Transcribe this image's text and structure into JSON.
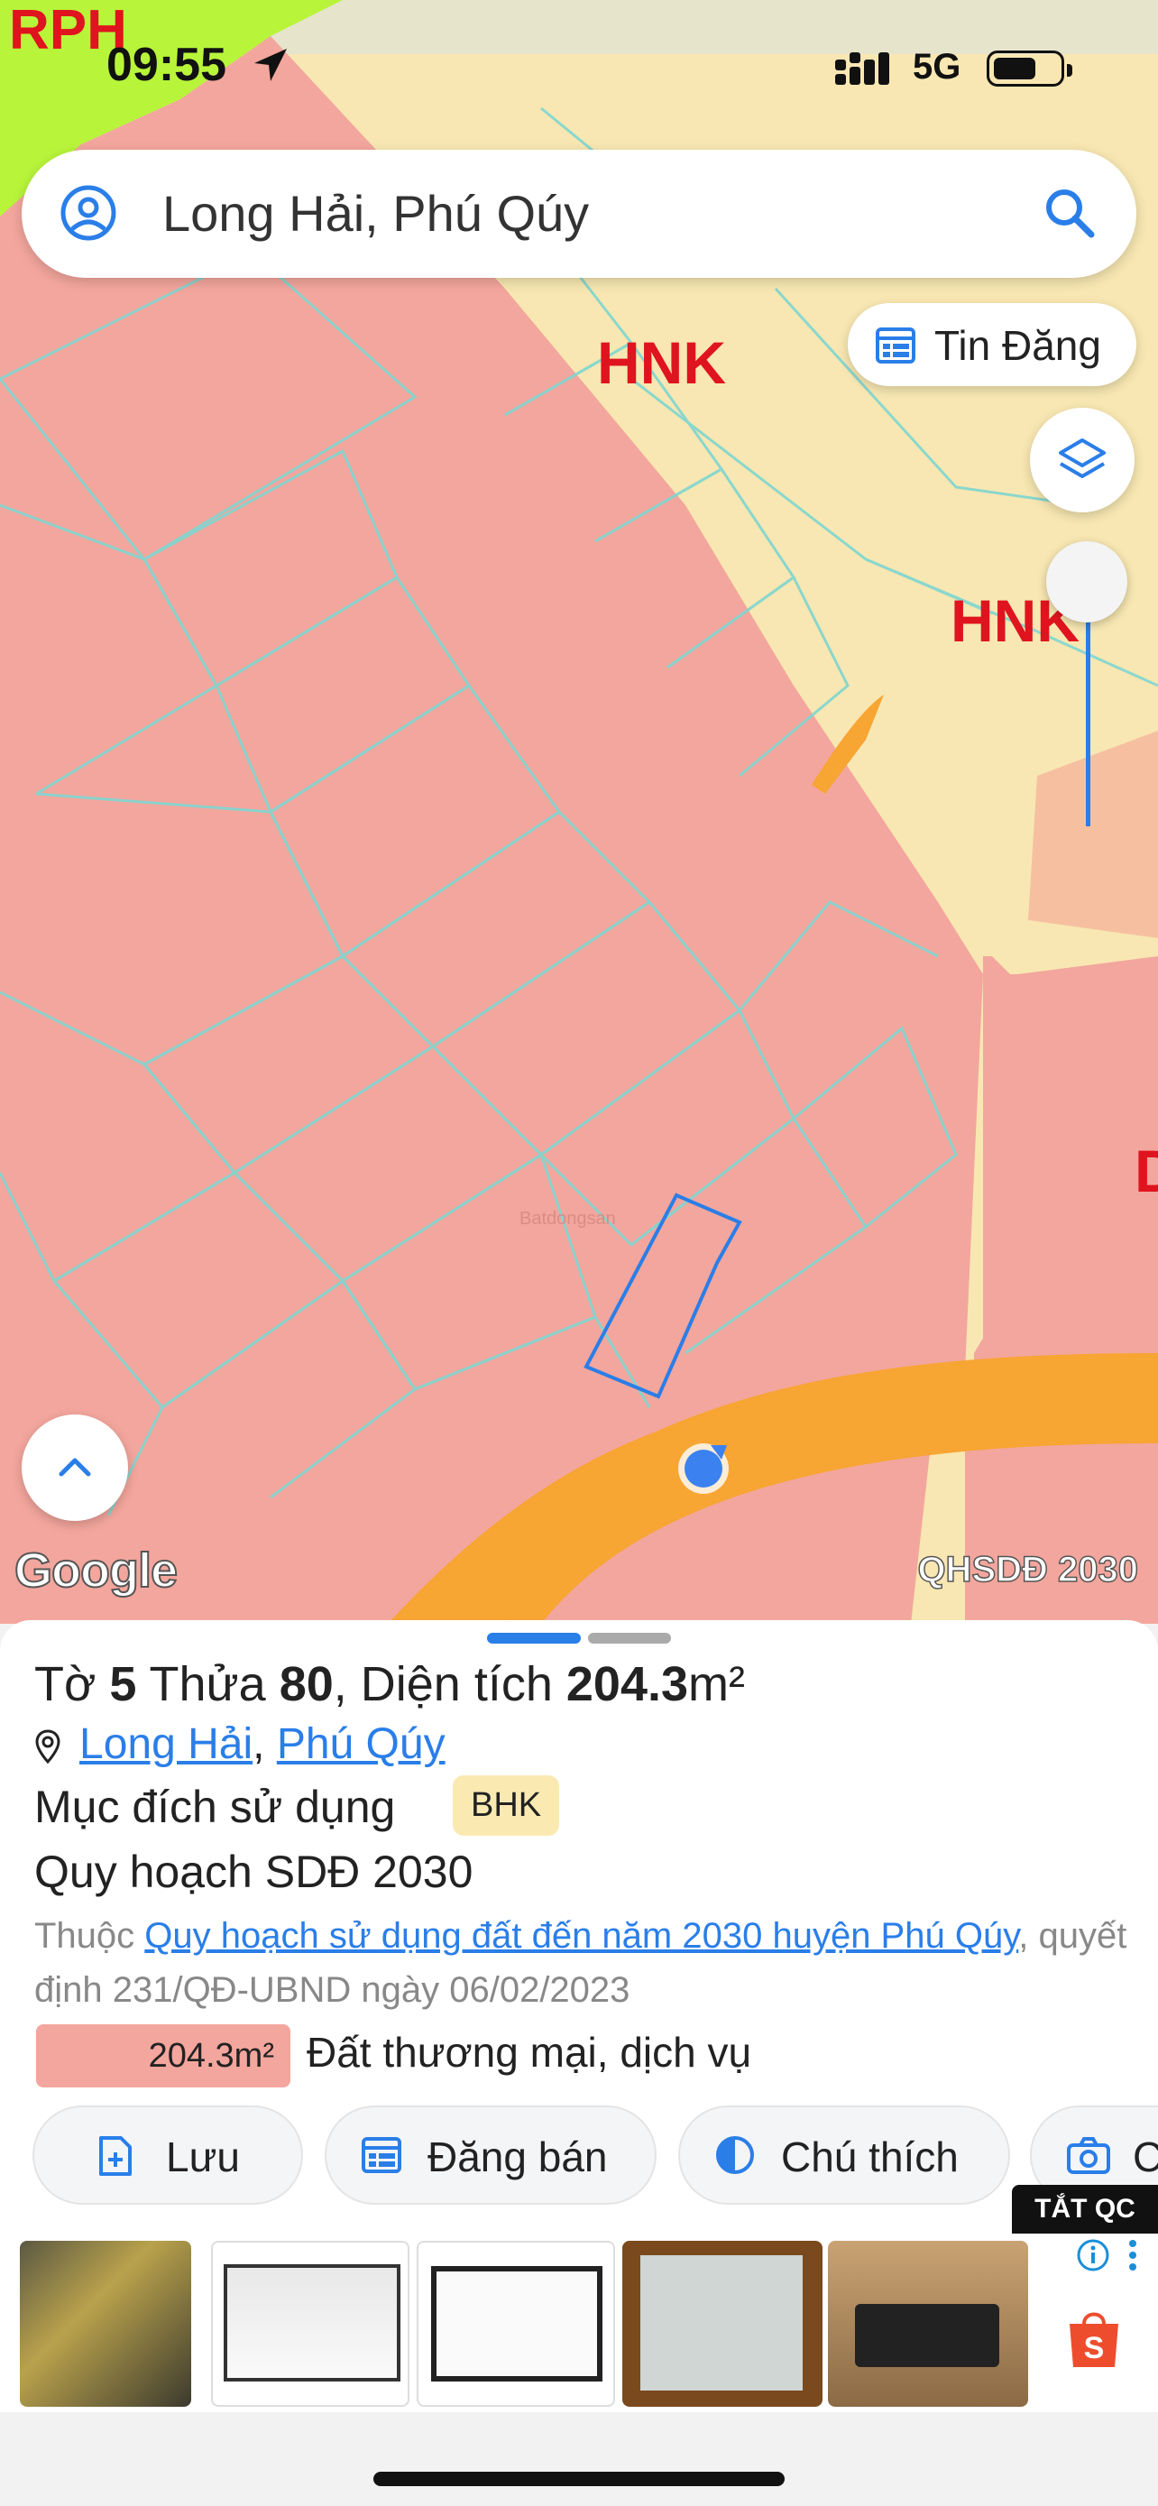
{
  "status": {
    "time": "09:55",
    "network": "5G",
    "battery_level": 0.6
  },
  "search": {
    "value": "Long Hải, Phú Qúy"
  },
  "buttons": {
    "tin_dang": "Tin Đăng"
  },
  "map": {
    "labels": {
      "rph": "RPH",
      "hnk_1": "HNK",
      "hnk_2": "HNK",
      "partial": "D"
    },
    "watermark": "Batdongsan",
    "google": "Google",
    "overlay": "QHSDĐ 2030",
    "colors": {
      "bhk": "#f3a69d",
      "hnk": "#f8e7b2",
      "road": "#f7a533",
      "rph": "#b8f53a",
      "highlight": "#2a7ee8"
    }
  },
  "sheet": {
    "title": {
      "prefix": "Tờ ",
      "sheet_no": "5",
      "mid": " Thửa ",
      "parcel_no": "80",
      "area_label": ", Diện tích ",
      "area": "204.3",
      "unit": "m²"
    },
    "location": {
      "ward": "Long Hải",
      "sep": ", ",
      "district": "Phú Qúy"
    },
    "purpose_label": "Mục đích sử dụng",
    "purpose_badge": "BHK",
    "plan_title": "Quy hoạch SDĐ 2030",
    "desc": {
      "prefix": "Thuộc ",
      "link": "Quy hoạch sử dụng đất đến năm 2030 huyện Phú Qúy",
      "suffix": ", quyết định 231/QĐ-UBND ngày 06/02/2023"
    },
    "area_box": "204.3m²",
    "area_desc": "Đất thương mại, dịch vụ"
  },
  "actions": [
    {
      "label": "Lưu",
      "icon": "doc-plus-icon"
    },
    {
      "label": "Đăng bán",
      "icon": "calendar-icon"
    },
    {
      "label": "Chú thích",
      "icon": "half-circle-icon"
    },
    {
      "label": "C",
      "icon": "camera-icon"
    }
  ],
  "ad": {
    "tag": "TẮT QC"
  }
}
